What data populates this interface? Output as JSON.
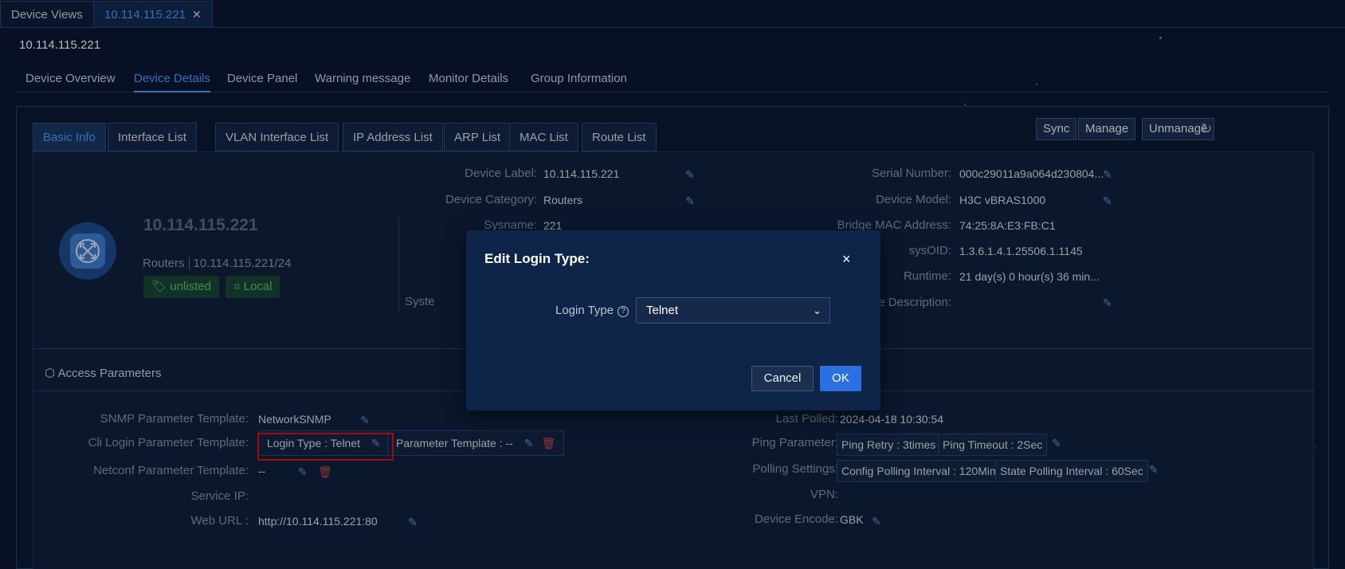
{
  "top_tabs": [
    {
      "label": "Device Views"
    },
    {
      "label": "10.114.115.221",
      "close": "✕"
    }
  ],
  "page_title": "10.114.115.221",
  "nav_tabs": [
    "Device Overview",
    "Device Details",
    "Device Panel",
    "Warning message",
    "Monitor Details",
    "Group Information"
  ],
  "sub_tabs": [
    "Basic Info",
    "Interface List",
    "VLAN Interface List",
    "IP Address List",
    "ARP List",
    "MAC List",
    "Route List"
  ],
  "actions": {
    "sync": "Sync",
    "manage": "Manage",
    "unmanage": "Unmanage"
  },
  "device": {
    "name": "10.114.115.221",
    "category": "Routers",
    "subnet": "10.114.115.221/24",
    "badges": [
      "unlisted",
      "Local"
    ]
  },
  "info_left": [
    {
      "label": "Device Label:",
      "value": "10.114.115.221"
    },
    {
      "label": "Device Category:",
      "value": "Routers"
    },
    {
      "label": "Sysname:",
      "value": "221"
    },
    {
      "label": "Syste",
      "value": ""
    }
  ],
  "info_right": [
    {
      "label": "Serial Number:",
      "value": "000c29011a9a064d230804..."
    },
    {
      "label": "Device Model:",
      "value": "H3C vBRAS1000"
    },
    {
      "label": "Bridge MAC Address:",
      "value": "74:25:8A:E3:FB:C1"
    },
    {
      "label": "sysOID:",
      "value": "1.3.6.1.4.1.25506.1.1145"
    },
    {
      "label": "Runtime:",
      "value": "21 day(s) 0 hour(s) 36 min..."
    },
    {
      "label": "Device Description:",
      "value": ""
    }
  ],
  "access": {
    "title": "Access Parameters",
    "left": {
      "snmp_label": "SNMP Parameter Template:",
      "snmp_value": "NetworkSNMP",
      "cli_label": "Cli Login Parameter Template:",
      "cli_login_type": "Login Type : Telnet",
      "cli_param_template": "Parameter Template : --",
      "netconf_label": "Netconf Parameter Template:",
      "netconf_value": "--",
      "service_ip_label": "Service IP:",
      "web_url_label": "Web URL :",
      "web_url_value": "http://10.114.115.221:80"
    },
    "right": {
      "last_polled_label": "Last Polled:",
      "last_polled_value": "2024-04-18 10:30:54",
      "ping_label": "Ping Parameter:",
      "ping_retry": "Ping Retry : 3times",
      "ping_timeout": "Ping Timeout : 2Sec",
      "polling_label": "Polling Settings:",
      "config_polling": "Config Polling Interval : 120Min",
      "state_polling": "State Polling Interval : 60Sec",
      "vpn_label": "VPN:",
      "encode_label": "Device Encode:",
      "encode_value": "GBK"
    }
  },
  "modal": {
    "title": "Edit Login Type:",
    "close": "×",
    "field_label": "Login Type",
    "selected": "Telnet",
    "cancel": "Cancel",
    "ok": "OK"
  },
  "icons": {
    "edit": "pencil-icon",
    "delete": "trash-icon",
    "refresh": "refresh-icon",
    "tag": "tag-icon",
    "sitemap": "sitemap-icon",
    "cube": "cube-icon",
    "help": "help-circle-icon",
    "chevron": "chevron-down-icon"
  },
  "colors": {
    "accent": "#4b9bff",
    "highlight": "#e01010",
    "ok_button": "#2b6fe0",
    "badge_green": "#67c07d"
  }
}
